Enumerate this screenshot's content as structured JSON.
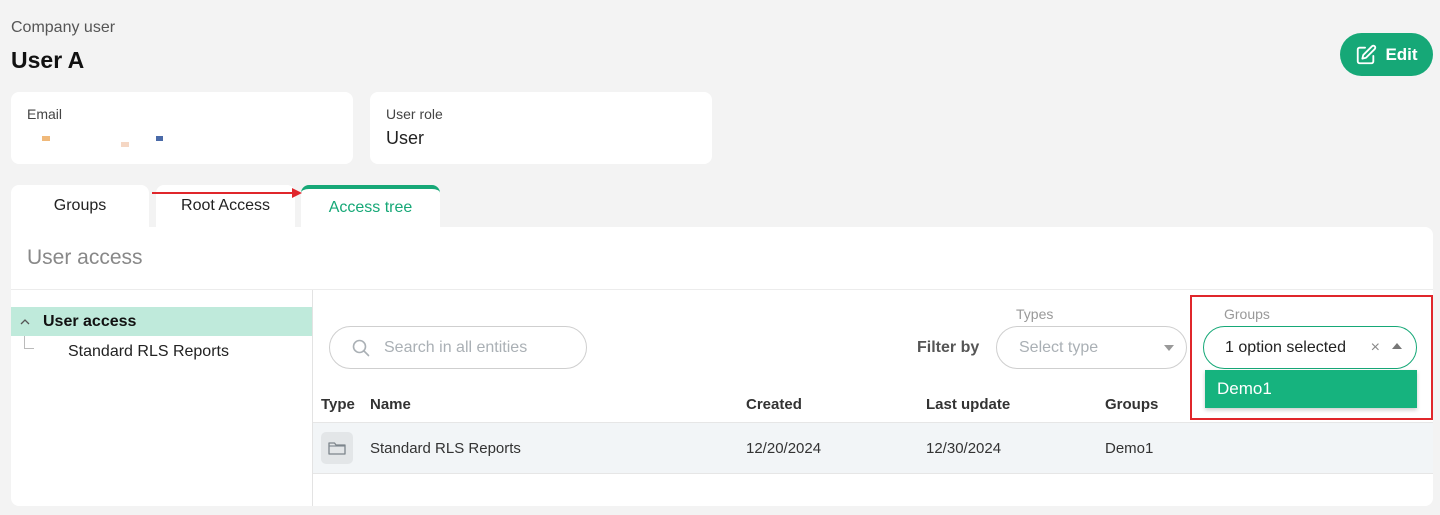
{
  "header": {
    "subtitle": "Company user",
    "title": "User A",
    "edit_label": "Edit"
  },
  "info_cards": {
    "email_label": "Email",
    "email_value": "",
    "role_label": "User role",
    "role_value": "User"
  },
  "tabs": [
    {
      "label": "Groups"
    },
    {
      "label": "Root Access"
    },
    {
      "label": "Access tree",
      "active": true
    }
  ],
  "panel": {
    "title": "User access",
    "tree": {
      "root_label": "User access",
      "child_label": "Standard RLS Reports"
    },
    "search": {
      "placeholder": "Search in all entities",
      "value": ""
    },
    "filter_label": "Filter by",
    "types": {
      "caption": "Types",
      "placeholder": "Select type"
    },
    "groups": {
      "caption": "Groups",
      "value": "1 option selected",
      "clear": "×",
      "options": [
        "Demo1"
      ]
    },
    "table": {
      "columns": [
        "Type",
        "Name",
        "Created",
        "Last update",
        "Groups"
      ],
      "rows": [
        {
          "type_icon": "folder-icon",
          "name": "Standard RLS Reports",
          "created": "12/20/2024",
          "last_update": "12/30/2024",
          "groups": "Demo1"
        }
      ]
    }
  },
  "colors": {
    "accent": "#16a877",
    "dropdown_option": "#16b37e",
    "tree_selected": "#bfeadb",
    "annotation_red": "#e0262b"
  }
}
